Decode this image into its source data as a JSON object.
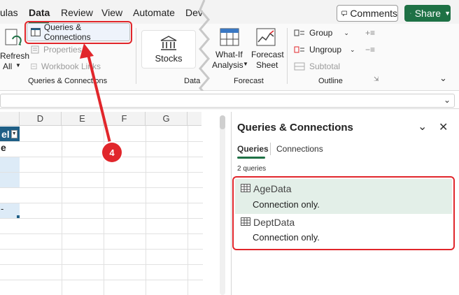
{
  "ribbon": {
    "tabs": [
      "ulas",
      "Data",
      "Review",
      "View",
      "Automate",
      "Dev"
    ],
    "active_tab": "Data",
    "comments_label": "Comments",
    "share_label": "Share",
    "refresh_label": "Refresh",
    "refresh_all_label": "All",
    "queries_connections_label": "Queries & Connections",
    "properties_label": "Properties",
    "workbook_links_label": "Workbook Links",
    "group_qc_label": "Queries & Connections",
    "stocks_label": "Stocks",
    "data_group_label": "Data",
    "whatif_label": "What-If",
    "analysis_label": "Analysis",
    "forecast_label": "Forecast",
    "sheet_label": "Sheet",
    "forecast_group_label": "Forecast",
    "group_label": "Group",
    "ungroup_label": "Ungroup",
    "subtotal_label": "Subtotal",
    "outline_group_label": "Outline"
  },
  "grid": {
    "columns": [
      "D",
      "E",
      "F",
      "G"
    ],
    "header_cell": "el",
    "row2_cell": "e",
    "row3_cell": "-"
  },
  "annotation": {
    "step_badge": "4"
  },
  "pane": {
    "title": "Queries & Connections",
    "tabs": [
      "Queries",
      "Connections"
    ],
    "active_tab": "Queries",
    "count_label": "2 queries",
    "queries": [
      {
        "name": "AgeData",
        "status": "Connection only."
      },
      {
        "name": "DeptData",
        "status": "Connection only."
      }
    ]
  },
  "colors": {
    "accent_green": "#1e7145",
    "callout_red": "#e1262b",
    "table_blue": "#1f5f86",
    "table_light": "#ddebf7"
  }
}
